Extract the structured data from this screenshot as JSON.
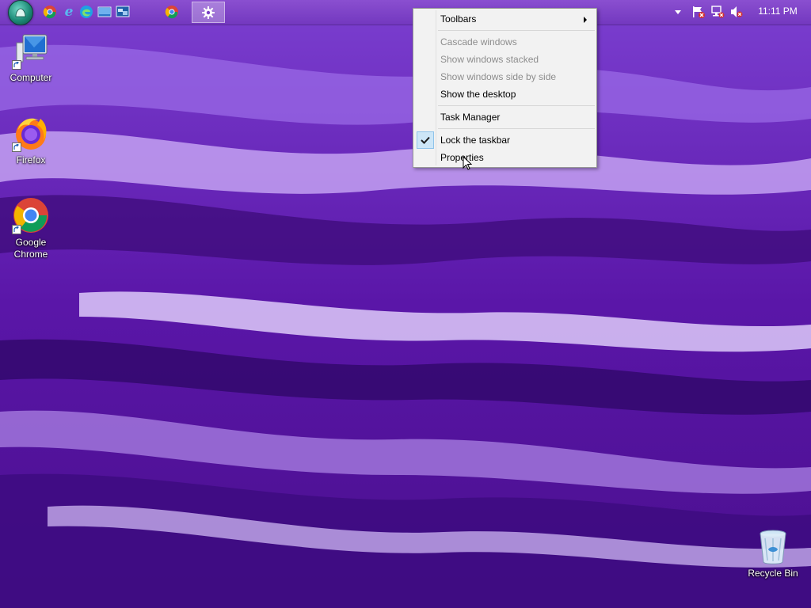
{
  "desktop": {
    "icons": [
      {
        "label": "Computer",
        "icon": "computer-icon"
      },
      {
        "label": "Firefox",
        "icon": "firefox-icon"
      },
      {
        "label": "Google\nChrome",
        "icon": "chrome-icon"
      },
      {
        "label": "Recycle Bin",
        "icon": "recycle-bin-icon"
      }
    ]
  },
  "taskbar": {
    "pinned": [
      "chrome-icon",
      "internet-explorer-icon",
      "edge-icon",
      "show-desktop-icon",
      "switch-windows-icon"
    ],
    "running": [
      "chrome-icon",
      "settings-gear-icon"
    ],
    "tray_icons": [
      "show-hidden-icons-chevron",
      "action-center-flag-icon",
      "network-icon",
      "volume-muted-icon"
    ],
    "clock": "11:11 PM"
  },
  "context_menu": {
    "items": [
      {
        "label": "Toolbars",
        "enabled": true,
        "submenu": true
      },
      {
        "label": "Cascade windows",
        "enabled": false
      },
      {
        "label": "Show windows stacked",
        "enabled": false
      },
      {
        "label": "Show windows side by side",
        "enabled": false
      },
      {
        "label": "Show the desktop",
        "enabled": true
      },
      {
        "label": "Task Manager",
        "enabled": true
      },
      {
        "label": "Lock the taskbar",
        "enabled": true,
        "checked": true
      },
      {
        "label": "Properties",
        "enabled": true
      }
    ]
  },
  "colors": {
    "wallpaper_base": "#5b1aa8",
    "taskbar": "#7a40c4",
    "menu_background": "#f2f2f2",
    "disabled_text": "#8d8d8d",
    "check_highlight": "#cde6f7"
  }
}
